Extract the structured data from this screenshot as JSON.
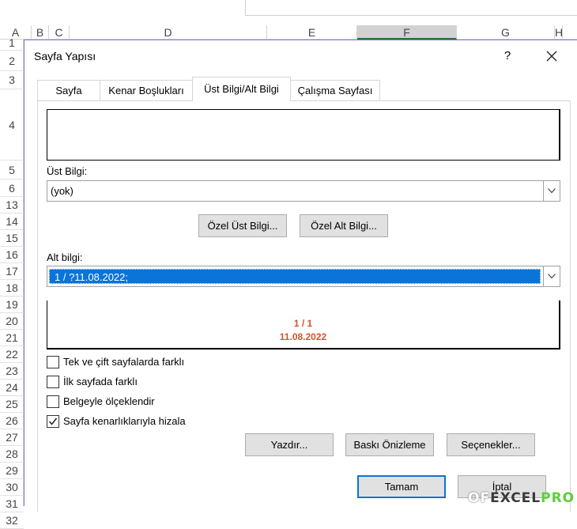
{
  "spreadsheet": {
    "columns": [
      {
        "label": "A",
        "sel": false
      },
      {
        "label": "B",
        "sel": false
      },
      {
        "label": "C",
        "sel": false
      },
      {
        "label": "D",
        "sel": false
      },
      {
        "label": "E",
        "sel": false
      },
      {
        "label": "F",
        "sel": true
      },
      {
        "label": "G",
        "sel": false
      },
      {
        "label": "H",
        "sel": false
      }
    ],
    "rows": [
      "1",
      "2",
      "3",
      "4",
      "5",
      "6",
      "13",
      "14",
      "15",
      "16",
      "17",
      "18",
      "19",
      "20",
      "21",
      "22",
      "23",
      "24",
      "25",
      "26",
      "27",
      "28",
      "29",
      "30",
      "31",
      "32"
    ]
  },
  "dialog": {
    "title": "Sayfa Yapısı",
    "help": "?",
    "close": "✕",
    "tabs": [
      {
        "label": "Sayfa",
        "active": false
      },
      {
        "label": "Kenar Boşlukları",
        "active": false
      },
      {
        "label": "Üst Bilgi/Alt Bilgi",
        "active": true
      },
      {
        "label": "Çalışma Sayfası",
        "active": false
      }
    ],
    "header_label": "Üst Bilgi:",
    "header_value": "(yok)",
    "custom_header_button": "Özel Üst Bilgi...",
    "custom_footer_button": "Özel Alt Bilgi...",
    "footer_label": "Alt bilgi:",
    "footer_value": "1 / ?11.08.2022;",
    "footer_preview_line1": "1 / 1",
    "footer_preview_line2": "11.08.2022",
    "checkboxes": [
      {
        "label": "Tek ve çift sayfalarda farklı",
        "checked": false
      },
      {
        "label": "İlk sayfada farklı",
        "checked": false
      },
      {
        "label": "Belgeyle ölçeklendir",
        "checked": false
      },
      {
        "label": "Sayfa kenarlıklarıyla hizala",
        "checked": true
      }
    ],
    "print_button": "Yazdır...",
    "preview_button": "Baskı Önizleme",
    "options_button": "Seçenekler...",
    "ok_button": "Tamam",
    "cancel_button": "İptal"
  },
  "watermark": {
    "part1": "OF",
    "part2": "EXCEL",
    "part3": "PRO"
  },
  "colors": {
    "accent": "#0a74d8",
    "preview_text": "#d2542c",
    "grid_select": "#217346"
  }
}
